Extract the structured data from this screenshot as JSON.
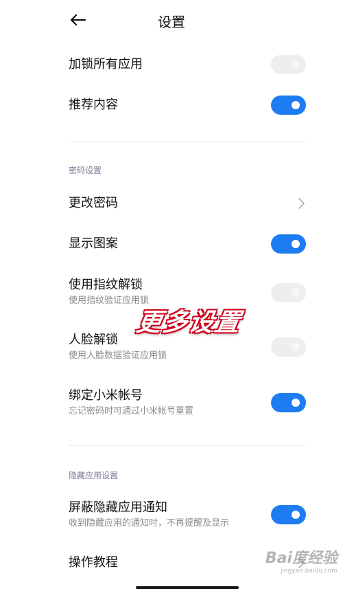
{
  "header": {
    "title": "设置",
    "back_icon": "back-arrow-icon"
  },
  "rows": {
    "lock_all_apps": {
      "title": "加锁所有应用",
      "toggle": "off"
    },
    "recommended_content": {
      "title": "推荐内容",
      "toggle": "on"
    },
    "change_password": {
      "title": "更改密码",
      "icon": "chevron-right-icon"
    },
    "show_pattern": {
      "title": "显示图案",
      "toggle": "on"
    },
    "fingerprint_unlock": {
      "title": "使用指纹解锁",
      "subtitle": "使用指纹验证应用锁",
      "toggle": "off"
    },
    "face_unlock": {
      "title": "人脸解锁",
      "subtitle": "使用人脸数据验证应用锁",
      "toggle": "off"
    },
    "bind_mi_account": {
      "title": "绑定小米帐号",
      "subtitle": "忘记密码时可通过小米帐号重置",
      "toggle": "on"
    },
    "block_hidden_notifications": {
      "title": "屏蔽隐藏应用通知",
      "subtitle": "收到隐藏应用的通知时，不再提醒及显示",
      "toggle": "on"
    },
    "tutorial": {
      "title": "操作教程",
      "icon": "chevron-right-icon"
    }
  },
  "sections": {
    "password_settings": "密码设置",
    "hidden_app_settings": "隐藏应用设置"
  },
  "overlay": {
    "text": "更多设置"
  },
  "watermark": {
    "brand": "Bai度经验",
    "url": "jingyan.baidu.com"
  },
  "colors": {
    "accent": "#1e7cf2",
    "toggle_off": "#eeeeee",
    "overlay_outline": "#d0021b"
  }
}
